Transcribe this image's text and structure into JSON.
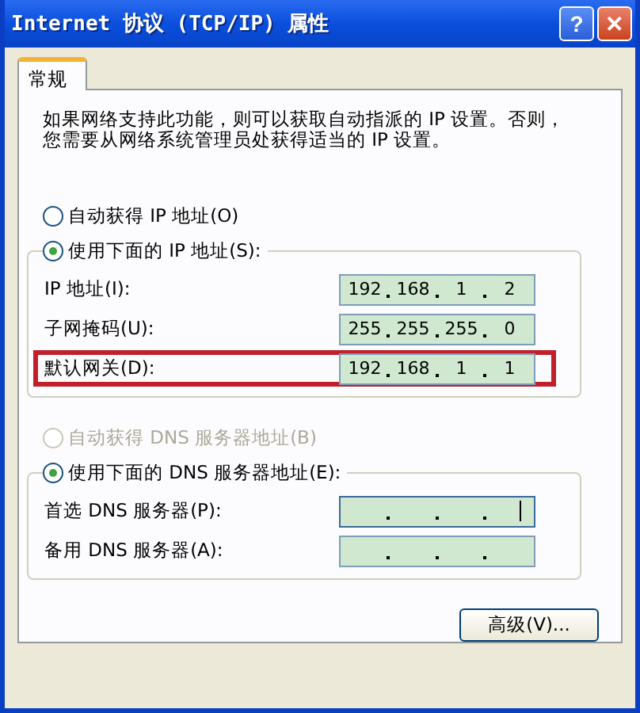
{
  "window": {
    "title": "Internet 协议 (TCP/IP) 属性",
    "buttons": [
      {
        "kind": "help",
        "label": "?"
      },
      {
        "kind": "close",
        "label": "✕"
      }
    ]
  },
  "tabs": [
    {
      "label": "常规",
      "selected": true
    }
  ],
  "description": "如果网络支持此功能，则可以获取自动指派的 IP 设置。否则，您需要从网络系统管理员处获得适当的 IP 设置。",
  "ip_section": {
    "radios": [
      {
        "label": "自动获得 IP 地址(O)",
        "selected": false,
        "disabled": false
      },
      {
        "label": "使用下面的 IP 地址(S):",
        "selected": true,
        "disabled": false
      }
    ],
    "fields": [
      {
        "label": "IP 地址(I):",
        "octets": [
          "192",
          "168",
          "1",
          "2"
        ],
        "highlighted": false,
        "focused": false
      },
      {
        "label": "子网掩码(U):",
        "octets": [
          "255",
          "255",
          "255",
          "0"
        ],
        "highlighted": false,
        "focused": false
      },
      {
        "label": "默认网关(D):",
        "octets": [
          "192",
          "168",
          "1",
          "1"
        ],
        "highlighted": true,
        "focused": false
      }
    ]
  },
  "dns_section": {
    "radios": [
      {
        "label": "自动获得 DNS 服务器地址(B)",
        "selected": false,
        "disabled": true
      },
      {
        "label": "使用下面的 DNS 服务器地址(E):",
        "selected": true,
        "disabled": false
      }
    ],
    "fields": [
      {
        "label": "首选 DNS 服务器(P):",
        "highlighted": false,
        "focused": true
      },
      {
        "label": "备用 DNS 服务器(A):",
        "highlighted": false,
        "focused": false
      }
    ]
  },
  "advanced_button": "高级(V)..."
}
